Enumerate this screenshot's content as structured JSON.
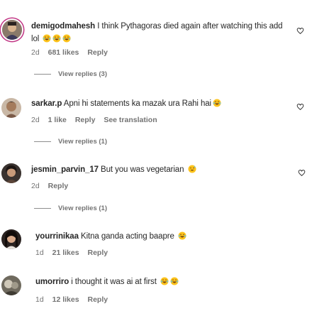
{
  "comments": [
    {
      "username": "demigodmahesh",
      "text": "I think Pythagoras died again after watching this add lol",
      "emojis": [
        "laughing-crying-emoji",
        "laughing-crying-emoji",
        "laughing-crying-emoji"
      ],
      "time": "2d",
      "likes": "681 likes",
      "reply": "Reply",
      "view_replies": "View replies (3)",
      "has_story_ring": true
    },
    {
      "username": "sarkar.p",
      "text": "Apni hi statements ka mazak ura Rahi hai",
      "emojis": [
        "laughing-crying-emoji"
      ],
      "time": "2d",
      "likes": "1 like",
      "reply": "Reply",
      "translation": "See translation",
      "view_replies": "View replies (1)"
    },
    {
      "username": "jesmin_parvin_17",
      "text": "But you was vegetarian",
      "emojis": [
        "grinning-sweat-emoji"
      ],
      "time": "2d",
      "reply": "Reply",
      "view_replies": "View replies (1)"
    },
    {
      "username": "yourrinikaa",
      "text": "Kitna ganda acting baapre",
      "emojis": [
        "laughing-crying-emoji"
      ],
      "time": "1d",
      "likes": "21 likes",
      "reply": "Reply"
    },
    {
      "username": "umorriro",
      "text": "i thought it was ai at first",
      "emojis": [
        "laughing-crying-emoji",
        "laughing-crying-emoji"
      ],
      "time": "1d",
      "likes": "12 likes",
      "reply": "Reply"
    }
  ],
  "colors": {
    "text": "#262626",
    "secondary": "#737373",
    "story_ring": "#c13584"
  },
  "icons": {
    "like": "heart-outline-icon"
  }
}
